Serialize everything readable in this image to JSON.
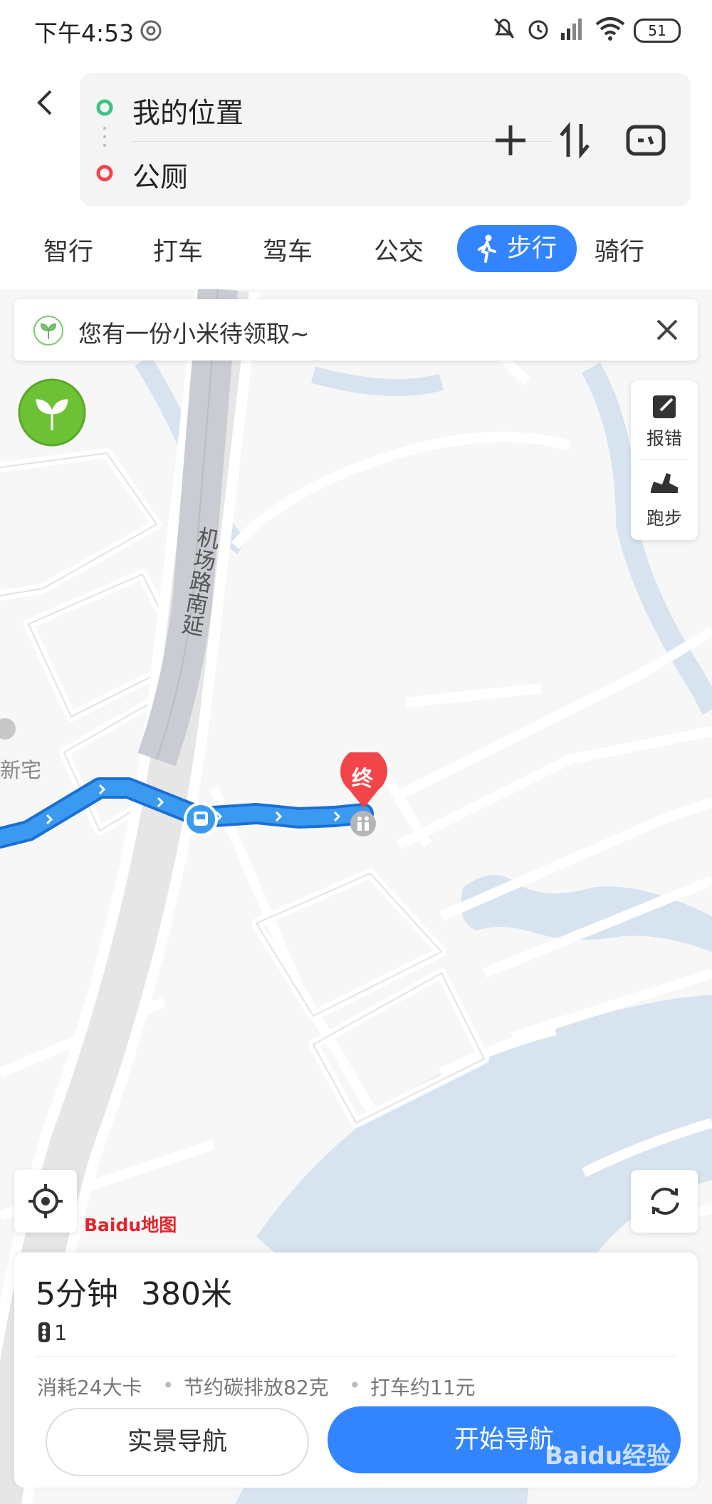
{
  "status_bar": {
    "time": "下午4:53",
    "battery": "51"
  },
  "route": {
    "origin": "我的位置",
    "destination": "公厕"
  },
  "tabs": [
    "智行",
    "打车",
    "驾车",
    "公交",
    "步行",
    "骑行"
  ],
  "active_tab": "步行",
  "banner": {
    "text": "您有一份小米待领取~"
  },
  "side_tools": {
    "report": "报错",
    "run": "跑步"
  },
  "map_labels": {
    "road": "机场路南延",
    "place": "新宅",
    "end_marker": "终"
  },
  "logo_text": "Baidu地图",
  "summary": {
    "time": "5分钟",
    "distance": "380米",
    "traffic_lights": "1",
    "calories": "消耗24大卡",
    "carbon": "节约碳排放82克",
    "taxi": "打车约11元"
  },
  "buttons": {
    "ar_nav": "实景导航",
    "start_nav": "开始导航"
  },
  "watermark": "Baidu经验",
  "colors": {
    "accent": "#3385ff",
    "route": "#3a9af0",
    "end_marker": "#f2454a"
  }
}
